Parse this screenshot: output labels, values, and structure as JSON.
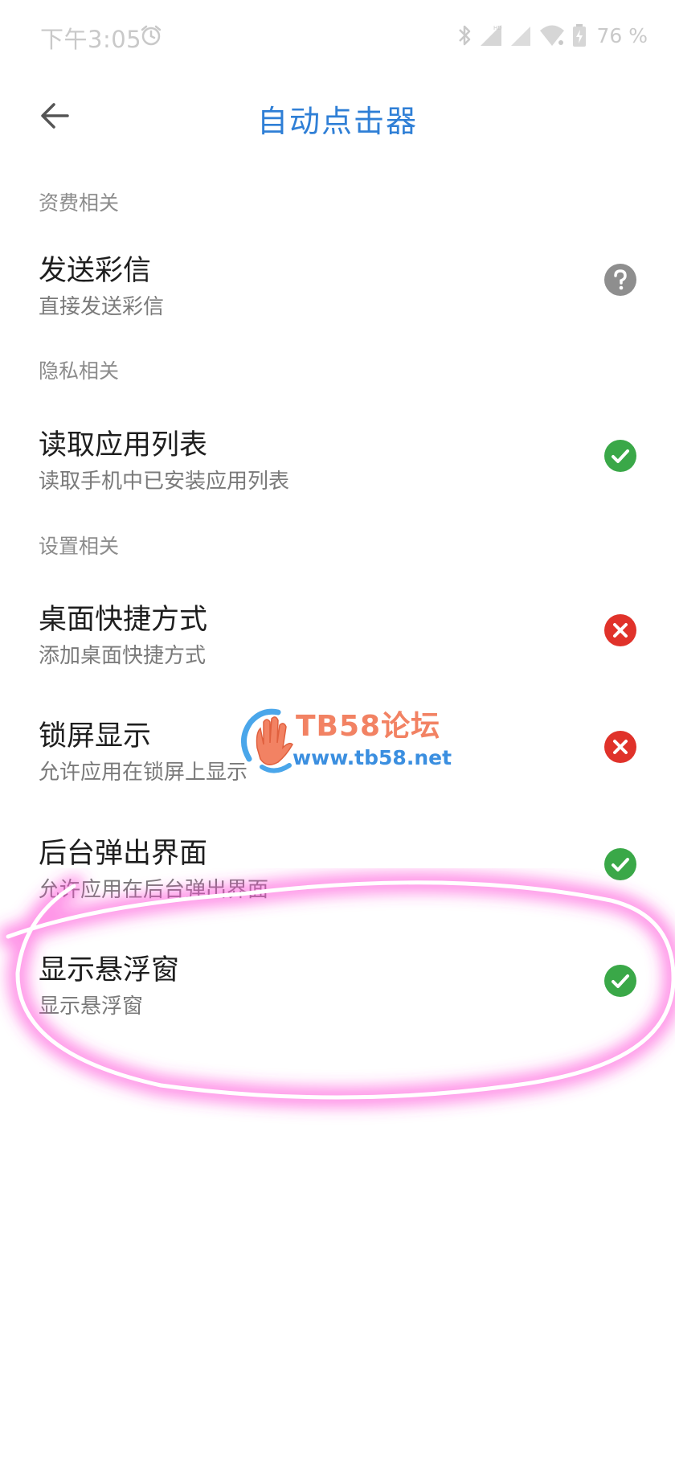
{
  "status_bar": {
    "time": "下午3:05",
    "battery_percent": "76 %"
  },
  "header": {
    "title": "自动点击器"
  },
  "sections": [
    {
      "header": "资费相关",
      "items": [
        {
          "title": "发送彩信",
          "description": "直接发送彩信",
          "status": "unknown"
        }
      ]
    },
    {
      "header": "隐私相关",
      "items": [
        {
          "title": "读取应用列表",
          "description": "读取手机中已安装应用列表",
          "status": "granted"
        }
      ]
    },
    {
      "header": "设置相关",
      "items": [
        {
          "title": "桌面快捷方式",
          "description": "添加桌面快捷方式",
          "status": "denied"
        },
        {
          "title": "锁屏显示",
          "description": "允许应用在锁屏上显示",
          "status": "denied"
        },
        {
          "title": "后台弹出界面",
          "description": "允许应用在后台弹出界面",
          "status": "granted"
        },
        {
          "title": "显示悬浮窗",
          "description": "显示悬浮窗",
          "status": "granted"
        }
      ]
    }
  ],
  "watermark": {
    "title": "TB58论坛",
    "url": "www.tb58.net"
  },
  "colors": {
    "title_blue": "#2f7fd6",
    "granted_green": "#3aa848",
    "denied_red": "#e0322a",
    "unknown_grey": "#8e8e8e",
    "highlight_pink": "#ff4fd8"
  },
  "icons": {
    "back": "arrow-left-icon",
    "alarm": "alarm-clock-icon",
    "bluetooth": "bluetooth-icon",
    "signal": "cell-signal-icon",
    "wifi": "wifi-icon",
    "battery": "battery-charging-icon",
    "granted": "check-circle-icon",
    "denied": "x-circle-icon",
    "unknown": "question-circle-icon"
  }
}
